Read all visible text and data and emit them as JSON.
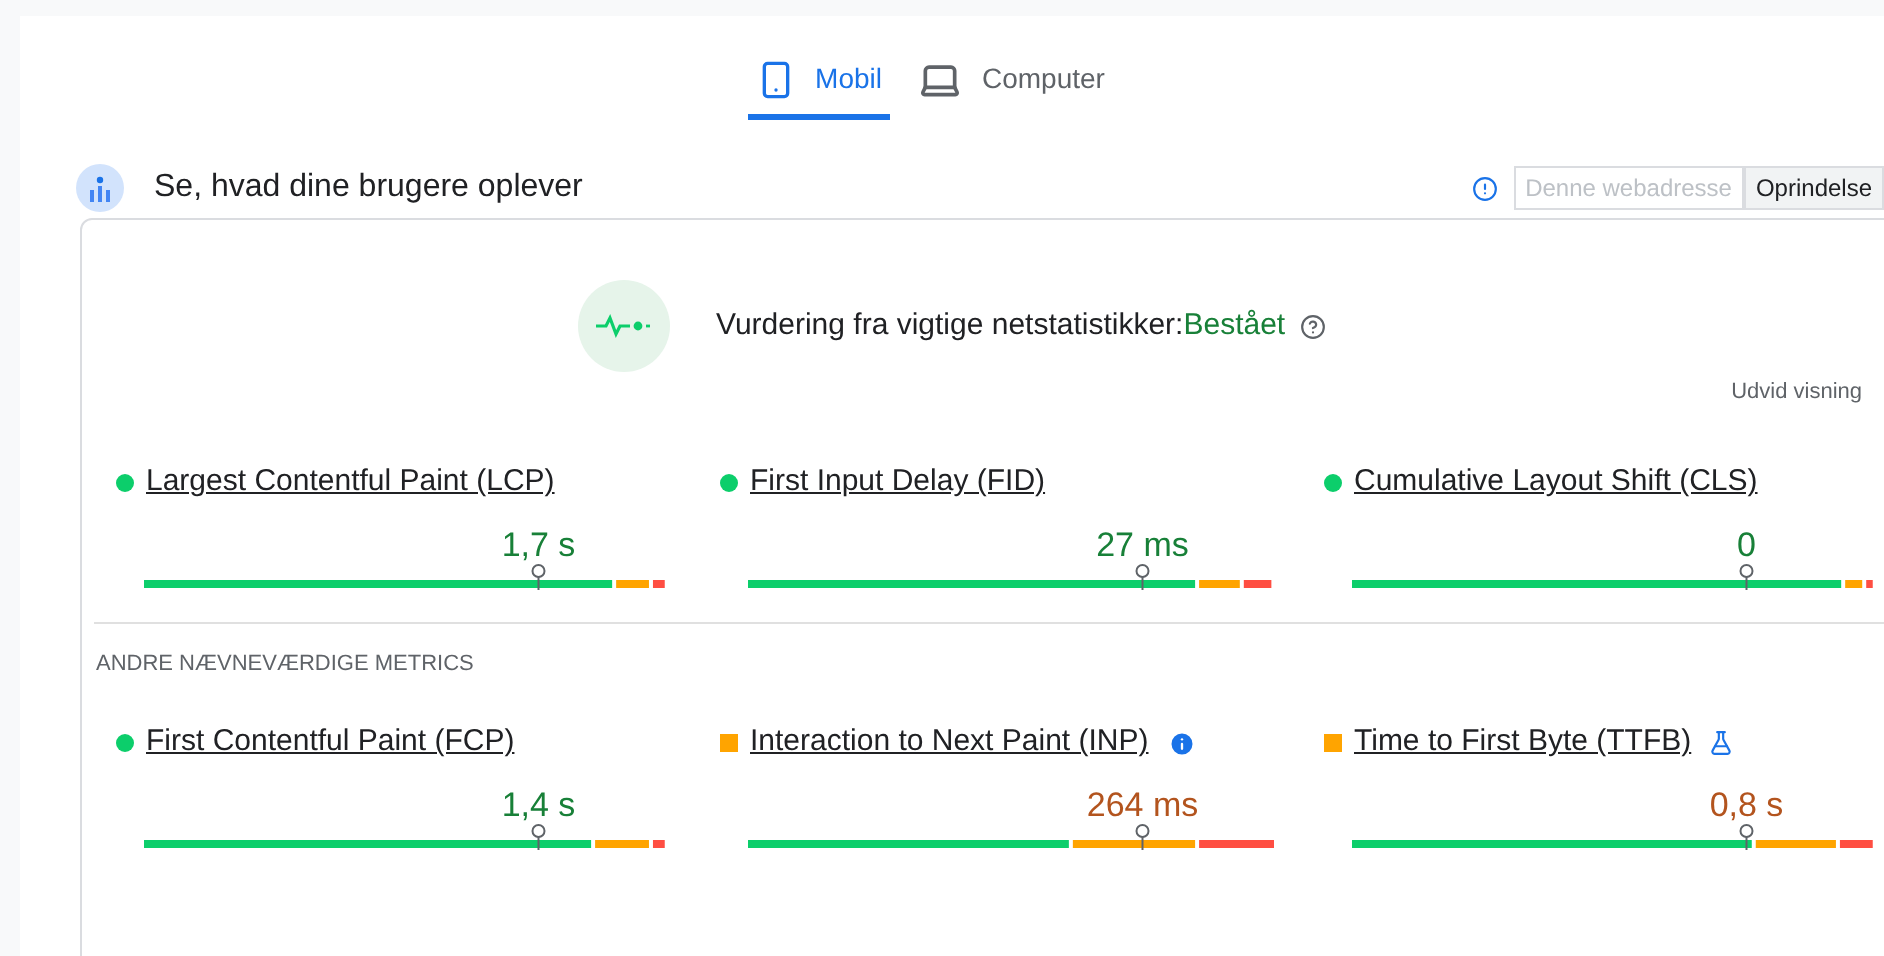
{
  "tabs": [
    {
      "label": "Mobil",
      "kind": "phone",
      "selected": true
    },
    {
      "label": "Computer",
      "kind": "laptop",
      "selected": false
    }
  ],
  "header": {
    "title": "Se, hvad dine brugere oplever",
    "toggle": [
      {
        "label": "Denne webadresse",
        "selected": false
      },
      {
        "label": "Oprindelse",
        "selected": true
      }
    ]
  },
  "assessment": {
    "label": "Vurdering fra vigtige netstatistikker:",
    "result": "Bestået",
    "expand": "Udvid visning"
  },
  "core_metrics": [
    {
      "name": "Largest Contentful Paint (LCP)",
      "kind": "good",
      "value": "1,7 s"
    },
    {
      "name": "First Input Delay (FID)",
      "kind": "good",
      "value": "27 ms"
    },
    {
      "name": "Cumulative Layout Shift (CLS)",
      "kind": "good",
      "value": "0"
    }
  ],
  "other_heading": "ANDRE NÆVNEVÆRDIGE METRICS",
  "other_metrics": [
    {
      "name": "First Contentful Paint (FCP)",
      "kind": "good",
      "value": "1,4 s"
    },
    {
      "name": "Interaction to Next Paint (INP)",
      "kind": "ni",
      "info": true,
      "value": "264 ms"
    },
    {
      "name": "Time to First Byte (TTFB)",
      "kind": "ni",
      "experimental": true,
      "value": "0,8 s"
    }
  ]
}
